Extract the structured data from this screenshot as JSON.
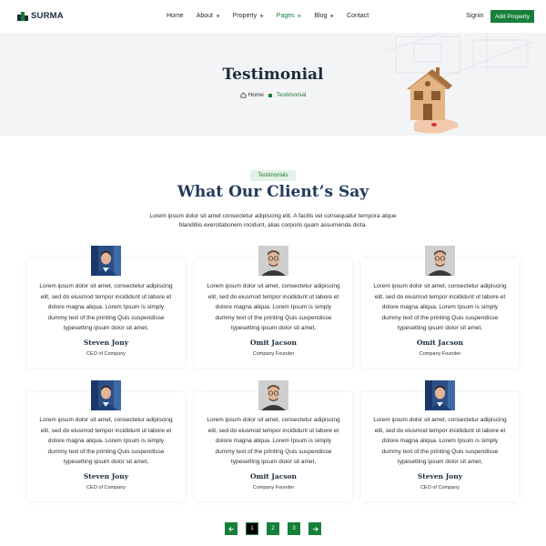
{
  "header": {
    "logo_text": "SURMA",
    "nav": [
      {
        "label": "Home",
        "has_plus": false,
        "active": false
      },
      {
        "label": "About",
        "has_plus": true,
        "active": false
      },
      {
        "label": "Property",
        "has_plus": true,
        "active": false
      },
      {
        "label": "Pages",
        "has_plus": true,
        "active": true
      },
      {
        "label": "Blog",
        "has_plus": true,
        "active": false
      },
      {
        "label": "Contact",
        "has_plus": false,
        "active": false
      }
    ],
    "signin": "Signin",
    "add_property": "Add Property"
  },
  "hero": {
    "title": "Testimonial",
    "breadcrumb_home": "Home",
    "breadcrumb_current": "Testimonial"
  },
  "section": {
    "tag": "Testimonials",
    "title": "What Our Client’s Say",
    "description": "Lorem ipsum dolor sit amet consectetur adipiscing elit. A facilis vel consequatur tempora atque blanditiis exercitationem incidunt, alias corporis quam assumenda dicta."
  },
  "testimonials": [
    {
      "text": "Lorem ipsum dolor sit amet, consectetur adipiscing elit, sed do eiusmod tempor incididunt ut labore et dolore magna aliqua. Lorem Ipsum is simply dummy text of the printing Quis suspendisse typesetting ipsum dolor sit amet,",
      "name": "Steven Jony",
      "role": "CEO of Company",
      "avatar": "man-blue-shirt"
    },
    {
      "text": "Lorem ipsum dolor sit amet, consectetur adipiscing elit, sed do eiusmod tempor incididunt ut labore et dolore magna aliqua. Lorem Ipsum is simply dummy text of the printing Quis suspendisse typesetting ipsum dolor sit amet,",
      "name": "Omit Jacson",
      "role": "Company Founder",
      "avatar": "man-glasses"
    },
    {
      "text": "Lorem ipsum dolor sit amet, consectetur adipiscing elit, sed do eiusmod tempor incididunt ut labore et dolore magna aliqua. Lorem Ipsum is simply dummy text of the printing Quis suspendisse typesetting ipsum dolor sit amet,",
      "name": "Omit Jacson",
      "role": "Company Founder",
      "avatar": "man-glasses"
    },
    {
      "text": "Lorem ipsum dolor sit amet, consectetur adipiscing elit, sed do eiusmod tempor incididunt ut labore et dolore magna aliqua. Lorem Ipsum is simply dummy text of the printing Quis suspendisse typesetting ipsum dolor sit amet,",
      "name": "Steven Jony",
      "role": "CEO of Company",
      "avatar": "man-blue-shirt"
    },
    {
      "text": "Lorem ipsum dolor sit amet, consectetur adipiscing elit, sed do eiusmod tempor incididunt ut labore et dolore magna aliqua. Lorem Ipsum is simply dummy text of the printing Quis suspendisse typesetting ipsum dolor sit amet,",
      "name": "Omit Jacson",
      "role": "Company Founder",
      "avatar": "man-glasses"
    },
    {
      "text": "Lorem ipsum dolor sit amet, consectetur adipiscing elit, sed do eiusmod tempor incididunt ut labore et dolore magna aliqua. Lorem Ipsum is simply dummy text of the printing Quis suspendisse typesetting ipsum dolor sit amet,",
      "name": "Steven Jony",
      "role": "CEO of Company",
      "avatar": "man-blue-shirt"
    }
  ],
  "pagination": {
    "prev_icon": "arrow-left-icon",
    "pages": [
      "1",
      "2",
      "3"
    ],
    "current": "1",
    "next_icon": "arrow-right-icon"
  },
  "colors": {
    "accent": "#16803b",
    "heading": "#233a5c",
    "hero_bg": "#f3f4f6"
  }
}
